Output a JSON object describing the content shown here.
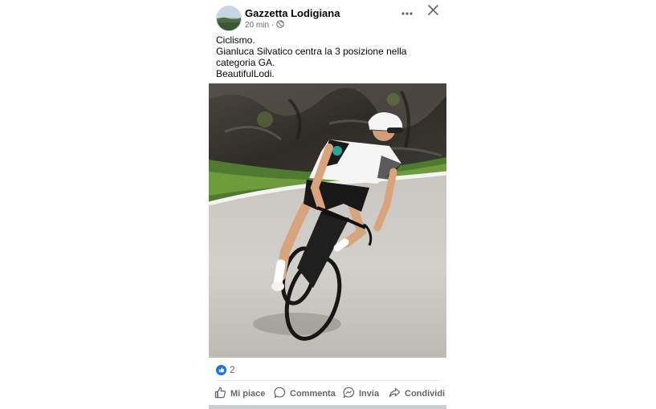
{
  "header": {
    "page_name": "Gazzetta Lodigiana",
    "time": "20 min",
    "separator": "·"
  },
  "post": {
    "lines": [
      "Ciclismo.",
      "Gianluca Silvatico centra la 3 posizione nella",
      "categoria GA.",
      "BeautifulLodi."
    ]
  },
  "reactions": {
    "count": "2",
    "icon": "like-icon",
    "color": "#1b74e4"
  },
  "actions": {
    "like": "Mi piace",
    "comment": "Commenta",
    "send": "Invia",
    "share": "Condividi"
  },
  "icons": {
    "more": "more-horizontal-icon",
    "close": "close-icon",
    "audience": "globe-icon"
  }
}
